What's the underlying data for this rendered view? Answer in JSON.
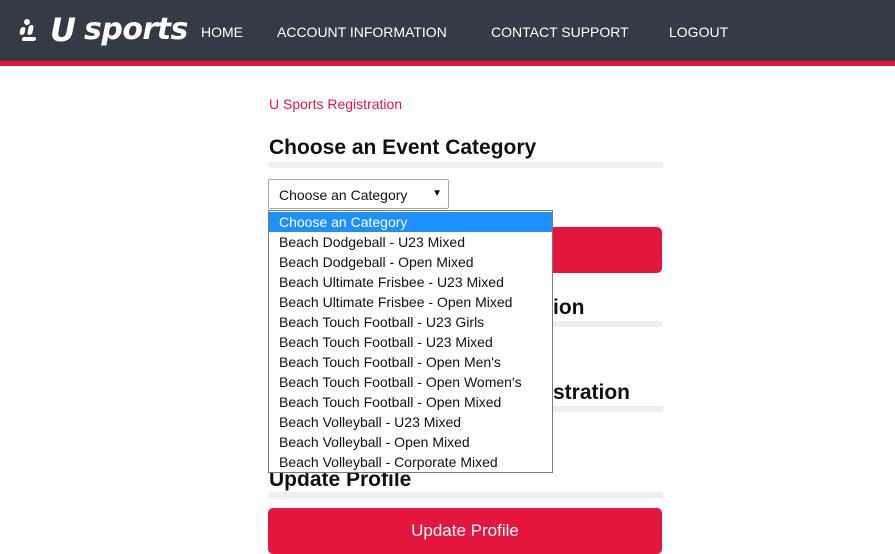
{
  "header": {
    "logo_text": "sports",
    "nav": [
      "HOME",
      "ACCOUNT INFORMATION",
      "CONTACT SUPPORT",
      "LOGOUT"
    ]
  },
  "breadcrumb": "U Sports Registration",
  "sections": {
    "event_category_title": "Choose an Event Category",
    "partial_1": "ion",
    "partial_2": "stration",
    "update_profile_title": "Update Profile"
  },
  "category_select": {
    "selected": "Choose an Category",
    "options": [
      "Choose an Category",
      "Beach Dodgeball - U23 Mixed",
      "Beach Dodgeball - Open Mixed",
      "Beach Ultimate Frisbee - U23 Mixed",
      "Beach Ultimate Frisbee - Open Mixed",
      "Beach Touch Football - U23 Girls",
      "Beach Touch Football - U23 Mixed",
      "Beach Touch Football - Open Men's",
      "Beach Touch Football - Open Women's",
      "Beach Touch Football - Open Mixed",
      "Beach Volleyball - U23 Mixed",
      "Beach Volleyball - Open Mixed",
      "Beach Volleyball - Corporate Mixed"
    ]
  },
  "buttons": {
    "update_profile": "Update Profile"
  },
  "colors": {
    "header_bg": "#323b46",
    "accent": "#e3173e",
    "selected_option": "#1e90ff"
  }
}
